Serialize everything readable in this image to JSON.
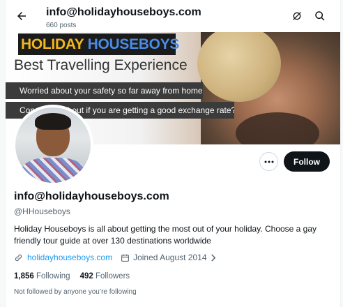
{
  "header": {
    "title": "info@holidayhouseboys.com",
    "post_count": "660 posts",
    "back_icon": "arrow-left-icon",
    "icons": [
      "muted-notification-icon",
      "search-icon"
    ]
  },
  "banner": {
    "logo_part1": "HOLIDAY",
    "logo_part2": " HOUSEBOYS",
    "slogan": "Best Travelling Experience",
    "line1": "Worried about your safety so far away from home?",
    "line2": "Concerned about if you are getting a good exchange rate?"
  },
  "actions": {
    "follow_label": "Follow",
    "more_icon": "more-horizontal-icon"
  },
  "profile": {
    "name": "info@holidayhouseboys.com",
    "handle": "@HHouseboys",
    "bio": "Holiday Houseboys is all about getting the most out of your holiday. Choose a gay friendly tour guide at over 130 destinations worldwide",
    "website": "holidayhouseboys.com",
    "joined": "Joined August 2014",
    "following_count": "1,856",
    "following_label": "Following",
    "followers_count": "492",
    "followers_label": "Followers",
    "followed_by_note": "Not followed by anyone you’re following"
  },
  "colors": {
    "accent": "#1d9bf0",
    "text": "#0f1419",
    "secondary": "#536471",
    "button_bg": "#0f1419"
  }
}
